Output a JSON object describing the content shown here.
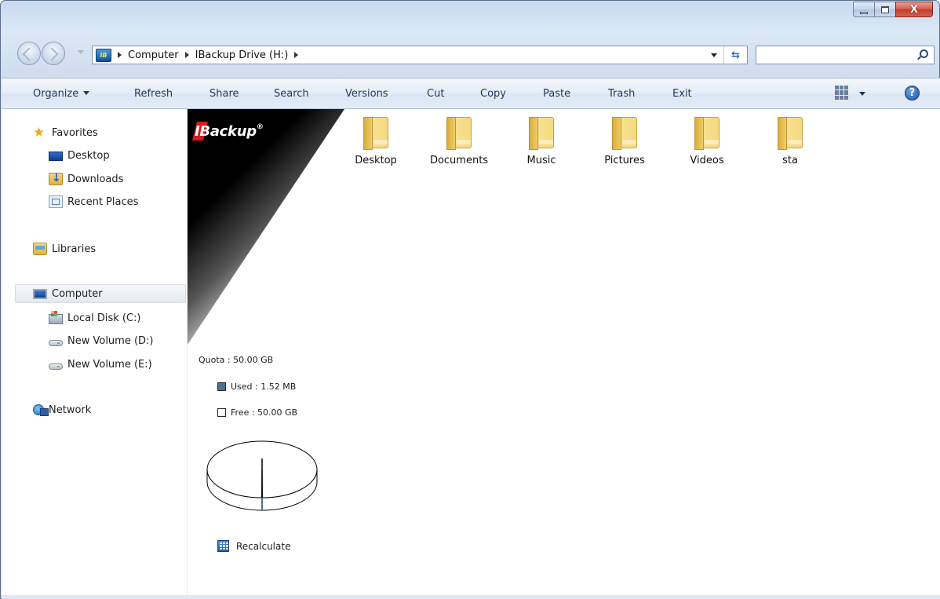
{
  "window": {
    "controls": {
      "close_glyph": "X"
    }
  },
  "address": {
    "drive_badge": "IB",
    "crumbs": [
      "Computer",
      "IBackup Drive (H:)"
    ],
    "refresh_glyph": "⁴⁺"
  },
  "search": {
    "placeholder": ""
  },
  "toolbar": {
    "items": [
      "Organize",
      "Refresh",
      "Share",
      "Search",
      "Versions",
      "Cut",
      "Copy",
      "Paste",
      "Trash",
      "Exit"
    ],
    "help_glyph": "?"
  },
  "sidebar": {
    "favorites": {
      "label": "Favorites",
      "items": [
        "Desktop",
        "Downloads",
        "Recent Places"
      ]
    },
    "libraries": {
      "label": "Libraries"
    },
    "computer": {
      "label": "Computer",
      "items": [
        "Local Disk (C:)",
        "New Volume (D:)",
        "New Volume (E:)"
      ]
    },
    "network": {
      "label": "Network"
    }
  },
  "content": {
    "logo": {
      "mark": "I",
      "rest": "Backup",
      "reg": "®"
    },
    "folders": [
      "Desktop",
      "Documents",
      "Music",
      "Pictures",
      "Videos",
      "sta"
    ],
    "quota": {
      "label": "Quota : 50.00 GB",
      "used_label": "Used : 1.52 MB",
      "free_label": "Free : 50.00 GB",
      "used_color": "#4f6f8f",
      "free_color": "#ffffff",
      "used_fraction": 3e-05
    },
    "recalculate": "Recalculate"
  }
}
